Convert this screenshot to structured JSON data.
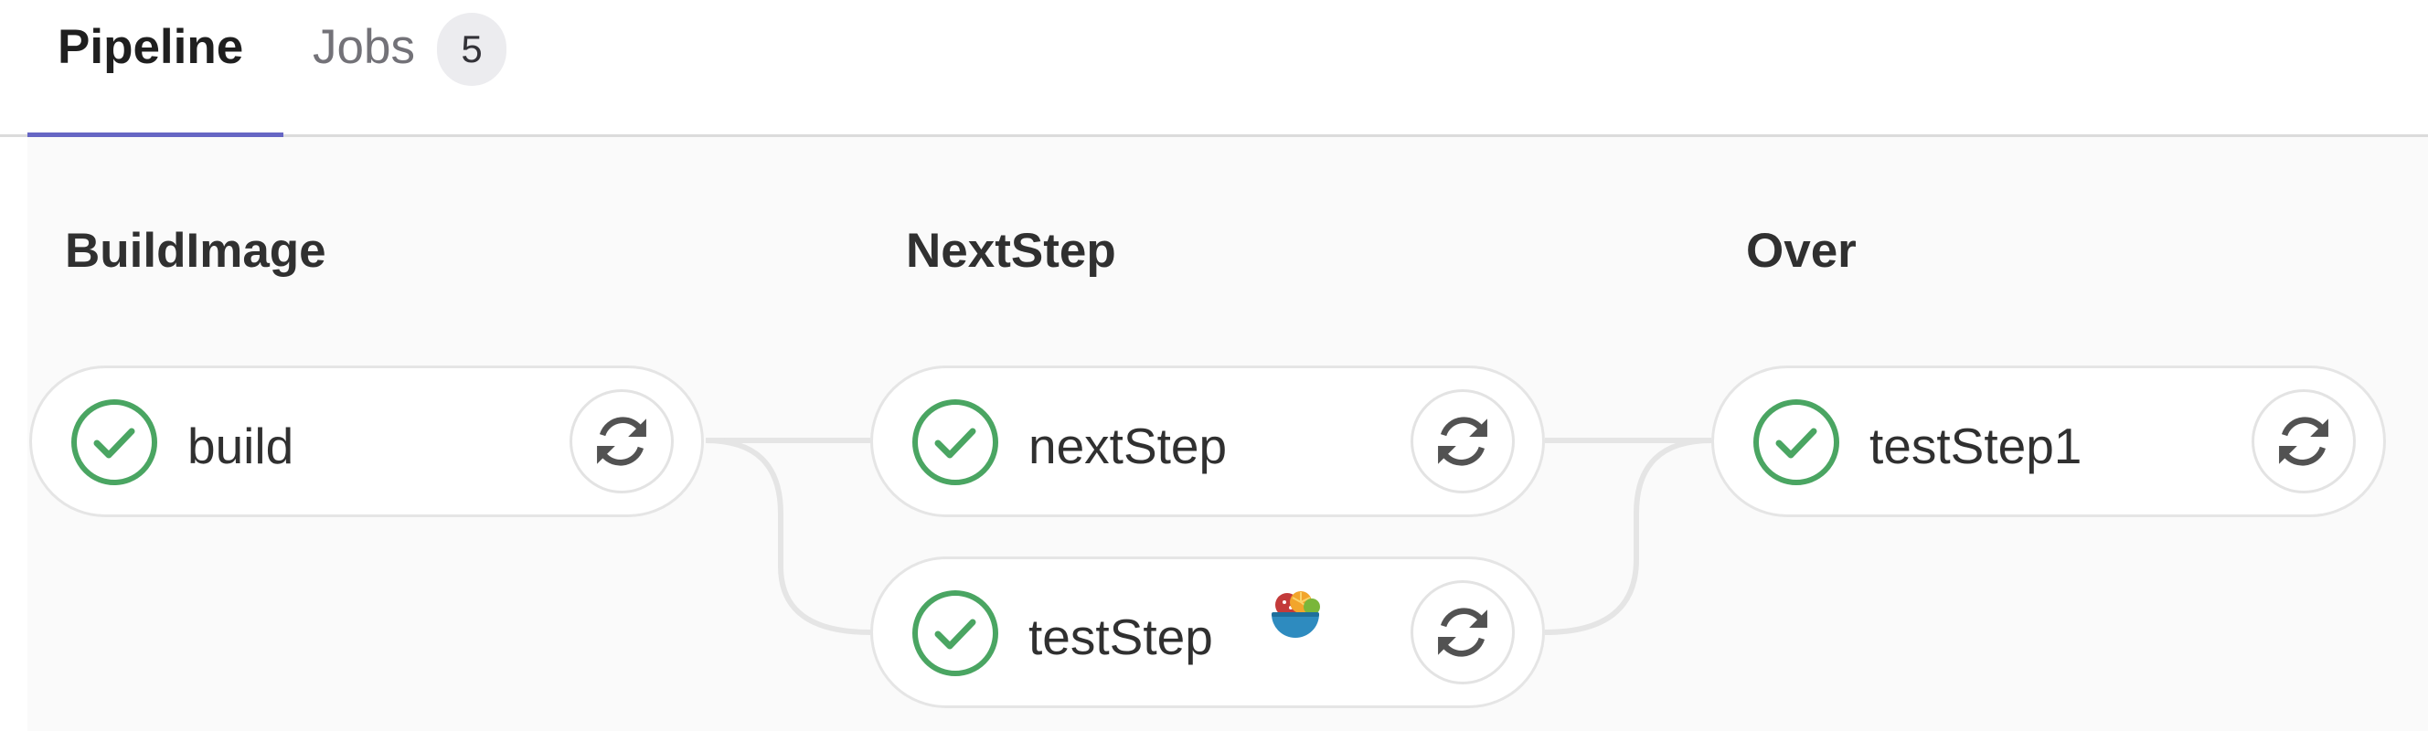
{
  "tabs": {
    "pipeline_label": "Pipeline",
    "jobs_label": "Jobs",
    "jobs_count": "5"
  },
  "stages": [
    {
      "title": "BuildImage",
      "jobs": [
        {
          "name": "build",
          "status": "success",
          "icon": "check-circle-icon"
        }
      ]
    },
    {
      "title": "NextStep",
      "jobs": [
        {
          "name": "nextStep",
          "status": "success",
          "icon": "check-circle-icon"
        },
        {
          "name": "testStep",
          "status": "success",
          "icon": "check-circle-icon",
          "extra_icon": "food-bowl-icon"
        }
      ]
    },
    {
      "title": "Over",
      "jobs": [
        {
          "name": "testStep1",
          "status": "success",
          "icon": "check-circle-icon"
        }
      ]
    }
  ],
  "colors": {
    "accent": "#6666c4",
    "success": "#4aa562",
    "connector": "#e5e5e5",
    "retry_icon": "#525252"
  }
}
